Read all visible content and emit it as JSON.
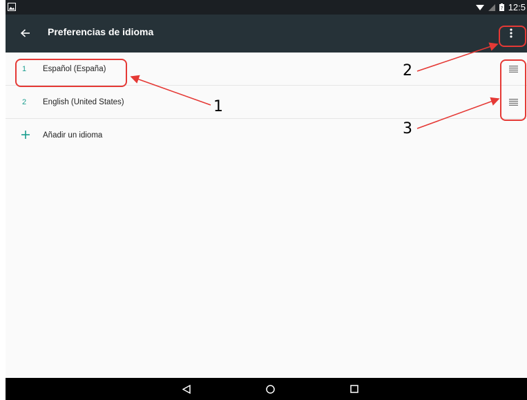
{
  "status_bar": {
    "time": "12:5",
    "icons": [
      "image-icon",
      "wifi-icon",
      "no-signal-icon",
      "battery-icon"
    ]
  },
  "app_bar": {
    "title": "Preferencias de idioma",
    "back_icon": "back-arrow-icon",
    "menu_icon": "overflow-menu-icon"
  },
  "languages": [
    {
      "index": "1",
      "label": "Español (España)"
    },
    {
      "index": "2",
      "label": "English (United States)"
    }
  ],
  "add_language": {
    "label": "Añadir un idioma",
    "icon": "plus-icon"
  },
  "nav_bar": {
    "icons": [
      "back-triangle-icon",
      "home-circle-icon",
      "recents-square-icon"
    ]
  },
  "annotations": {
    "markers": [
      "1",
      "2",
      "3"
    ],
    "color": "#e53935"
  },
  "colors": {
    "app_bar": "#263238",
    "status_bar": "#1b1f23",
    "accent": "#1a9e8e",
    "background": "#fafafa"
  }
}
